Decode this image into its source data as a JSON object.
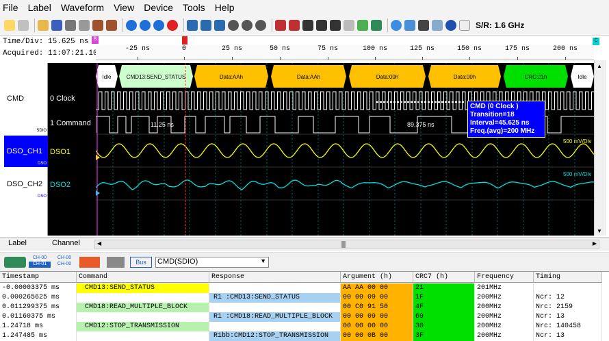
{
  "menu": [
    "File",
    "Label",
    "Waveform",
    "View",
    "Device",
    "Tools",
    "Help"
  ],
  "toolbar": {
    "sample_rate": "S/R: 1.6 GHz"
  },
  "info": {
    "time_div": "Time/Div: 15.625 ns",
    "acquired": "Acquired: 11:07:21.10",
    "marker_b": "B",
    "marker_c": "C",
    "ticks": [
      "-25 ns",
      "0",
      "25 ns",
      "50 ns",
      "75 ns",
      "100 ns",
      "125 ns",
      "150 ns",
      "175 ns",
      "200 ns"
    ]
  },
  "labels": [
    {
      "name": "CMD",
      "sub": "SDIO"
    },
    {
      "name": "DSO_CH1",
      "sub": "DSO"
    },
    {
      "name": "DSO_CH2",
      "sub": "DSO"
    }
  ],
  "channels": [
    "0 Clock",
    "1 Command",
    "DSO1",
    "DSO2"
  ],
  "bus": {
    "segments": [
      "Idle",
      "CMD13:SEND_STATUS",
      "Data:AAh",
      "Data:AAh",
      "Data:00h",
      "Data:00h",
      "CRC:21h",
      "Idle"
    ]
  },
  "measurements": {
    "m1": "11.25 ns",
    "m2": "89.375 ns"
  },
  "scale": {
    "ch1": "500 mV/Div",
    "ch2": "500 mV/Div"
  },
  "tooltip": {
    "line1": "CMD (0 Clock )",
    "line2": "Transition=18",
    "line3": "Interval=45.625 ns",
    "line4": "Freq.(avg)=200 MHz"
  },
  "tabs": {
    "label": "Label",
    "channel": "Channel"
  },
  "decode": {
    "ch_badge1": "CH-00",
    "ch_badge2": "CH-01",
    "ch_badge3": "CH-00",
    "ch_badge4": "CH-00",
    "bus_label": "Bus",
    "bus_value": "CMD(SDIO)"
  },
  "table": {
    "headers": [
      "Timestamp",
      "Command",
      "Response",
      "Argument (h)",
      "CRC7 (h)",
      "Frequency",
      "Timing"
    ],
    "rows": [
      {
        "ts": "-0.00003375 ms",
        "cmd": "CMD13:SEND_STATUS",
        "resp": "",
        "arg": "AA AA 00 00",
        "crc": "21",
        "freq": "201MHz",
        "timing": ""
      },
      {
        "ts": "0.000265625 ms",
        "cmd": "",
        "resp": "R1 :CMD13:SEND_STATUS",
        "arg": "00 00 09 00",
        "crc": "1F",
        "freq": "200MHz",
        "timing": "Ncr: 12"
      },
      {
        "ts": "0.011299375 ms",
        "cmd": "CMD18:READ_MULTIPLE_BLOCK",
        "resp": "",
        "arg": "00 C0 91 50",
        "crc": "4F",
        "freq": "200MHz",
        "timing": "Nrc: 2159"
      },
      {
        "ts": "0.01160375 ms",
        "cmd": "",
        "resp": "R1 :CMD18:READ_MULTIPLE_BLOCK",
        "arg": "00 00 09 00",
        "crc": "69",
        "freq": "200MHz",
        "timing": "Ncr: 13"
      },
      {
        "ts": "1.24718 ms",
        "cmd": "CMD12:STOP_TRANSMISSION",
        "resp": "",
        "arg": "00 00 00 00",
        "crc": "30",
        "freq": "200MHz",
        "timing": "Nrc: 140458"
      },
      {
        "ts": "1.247485 ms",
        "cmd": "",
        "resp": "R1bb:CMD12:STOP_TRANSMISSION",
        "arg": "00 00 0B 00",
        "crc": "3F",
        "freq": "200MHz",
        "timing": "Ncr: 13"
      }
    ]
  },
  "colors": {
    "bus_idle": "#ffffff",
    "bus_cmd": "#ccffcc",
    "bus_data": "#ffc000",
    "bus_crc": "#00e000",
    "wave_yellow": "#ffff00",
    "wave_cyan": "#00e0e0",
    "selected_label": "#0000ff"
  }
}
